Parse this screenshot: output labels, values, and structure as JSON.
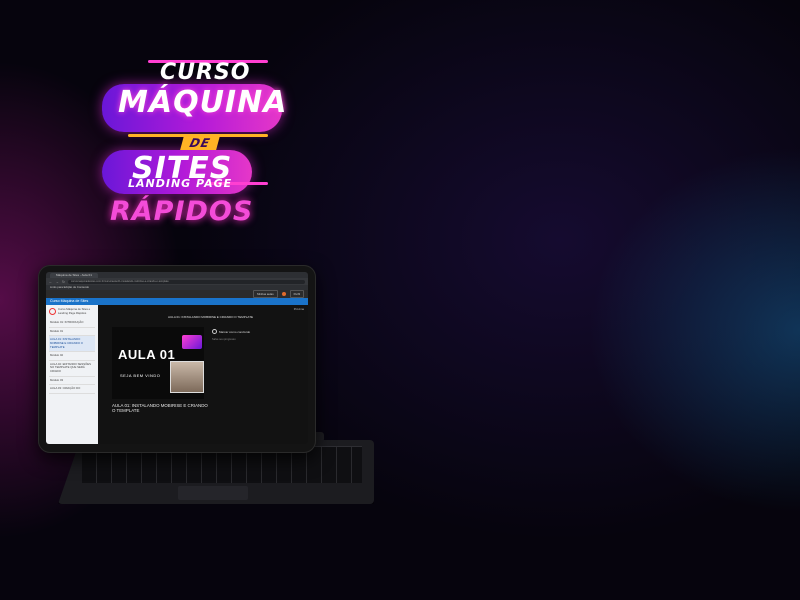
{
  "logo": {
    "curso": "CURSO",
    "maquina": "MÁQUINA",
    "de": "DE",
    "sites": "SITES",
    "landing_page": "LANDING PAGE",
    "rapidos": "RÁPIDOS"
  },
  "tablet_screen": {
    "browser_tab": "Máquina de Sites - Aula 01",
    "url": "cursomaquinadesites.com.br/curso/aula-01-instalando-mobirise-e-criando-o-template",
    "bookmarks_bar": "Links para Edição de Conteúdo",
    "topbar_buttons": [
      "Minhas aulas",
      "Perfil"
    ],
    "course_title": "Curso Máquina de Sites",
    "breadcrumb": "Próxima",
    "lesson_header": "AULA 01: INSTALANDO MOBIRISE E CRIANDO O TEMPLATE",
    "sidebar": {
      "course_name": "Curso Máquina de Sites e Landing Page Rápidos",
      "items": [
        "Módulo 01: INTRODUÇÃO",
        "Módulo 01",
        "AULA 01: INSTALANDO MOBIRISE E CRIANDO O TEMPLATE",
        "Módulo 02",
        "AULA 02: EDITANDO SESSÕES NO TEMPLATE QUE SERÁ CRIADO",
        "Módulo 03",
        "AULA 03: CRIAÇÃO DO"
      ]
    },
    "video": {
      "title_text": "AULA 01",
      "subtitle_text": "SEJA BEM VINDO"
    },
    "lesson_caption": "AULA 01: INSTALANDO MOBIRISE E CRIANDO O TEMPLATE",
    "mark_done": "Marcar como concluído",
    "note": "Salve seu progresso"
  }
}
